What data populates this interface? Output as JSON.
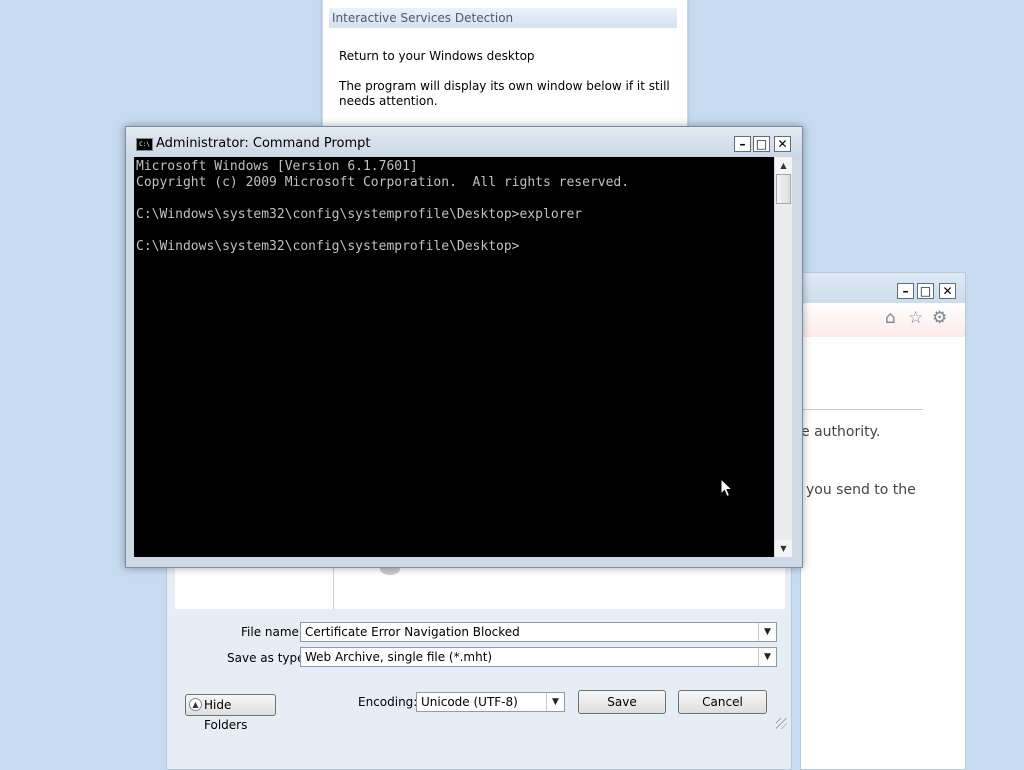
{
  "isd": {
    "title": "Interactive Services Detection",
    "line1": "Return to your Windows desktop",
    "line2": "The program will display its own window below if it still needs attention."
  },
  "browser": {
    "text1": "e authority.",
    "text2": "you send to the",
    "icons": [
      "home-icon",
      "star-icon",
      "gear-icon"
    ]
  },
  "save_dialog": {
    "filename_label": "File name:",
    "filename_value": "Certificate Error Navigation Blocked",
    "type_label": "Save as type:",
    "type_value": "Web Archive, single file (*.mht)",
    "hide_folders": "Hide Folders",
    "encoding_label": "Encoding:",
    "encoding_value": "Unicode (UTF-8)",
    "save": "Save",
    "cancel": "Cancel"
  },
  "cmd": {
    "title": "Administrator:  Command Prompt",
    "output": "Microsoft Windows [Version 6.1.7601]\nCopyright (c) 2009 Microsoft Corporation.  All rights reserved.\n\nC:\\Windows\\system32\\config\\systemprofile\\Desktop>explorer\n\nC:\\Windows\\system32\\config\\systemprofile\\Desktop>"
  }
}
